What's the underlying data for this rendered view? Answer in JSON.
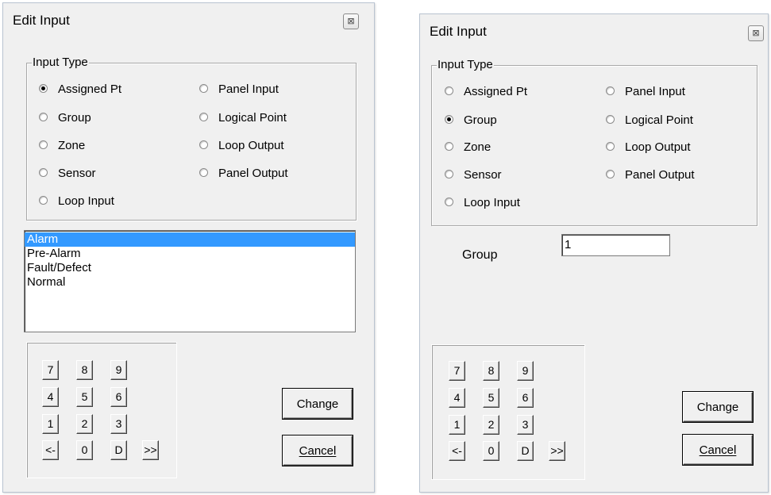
{
  "left_dialog": {
    "title": "Edit Input",
    "close_glyph": "⊠",
    "input_type": {
      "legend": "Input Type",
      "left_options": [
        {
          "label": "Assigned Pt",
          "checked": true
        },
        {
          "label": "Group",
          "checked": false
        },
        {
          "label": "Zone",
          "checked": false
        },
        {
          "label": "Sensor",
          "checked": false
        },
        {
          "label": "Loop Input",
          "checked": false
        }
      ],
      "right_options": [
        {
          "label": "Panel Input",
          "checked": false
        },
        {
          "label": "Logical Point",
          "checked": false
        },
        {
          "label": "Loop Output",
          "checked": false
        },
        {
          "label": "Panel Output",
          "checked": false
        }
      ]
    },
    "state_list": {
      "items": [
        "Alarm",
        "Pre-Alarm",
        "Fault/Defect",
        "Normal"
      ],
      "selected": "Alarm"
    },
    "keypad": {
      "row1": [
        "7",
        "8",
        "9"
      ],
      "row2": [
        "4",
        "5",
        "6"
      ],
      "row3": [
        "1",
        "2",
        "3"
      ],
      "row4": [
        "<-",
        "0",
        "D",
        ">>"
      ]
    },
    "buttons": {
      "change": "Change",
      "cancel": "Cancel"
    }
  },
  "right_dialog": {
    "title": "Edit Input",
    "close_glyph": "⊠",
    "input_type": {
      "legend": "Input Type",
      "left_options": [
        {
          "label": "Assigned Pt",
          "checked": false
        },
        {
          "label": "Group",
          "checked": true
        },
        {
          "label": "Zone",
          "checked": false
        },
        {
          "label": "Sensor",
          "checked": false
        },
        {
          "label": "Loop Input",
          "checked": false
        }
      ],
      "right_options": [
        {
          "label": "Panel Input",
          "checked": false
        },
        {
          "label": "Logical Point",
          "checked": false
        },
        {
          "label": "Loop Output",
          "checked": false
        },
        {
          "label": "Panel Output",
          "checked": false
        }
      ]
    },
    "group_field": {
      "label": "Group",
      "value": "1"
    },
    "keypad": {
      "row1": [
        "7",
        "8",
        "9"
      ],
      "row2": [
        "4",
        "5",
        "6"
      ],
      "row3": [
        "1",
        "2",
        "3"
      ],
      "row4": [
        "<-",
        "0",
        "D",
        ">>"
      ]
    },
    "buttons": {
      "change": "Change",
      "cancel": "Cancel"
    }
  }
}
